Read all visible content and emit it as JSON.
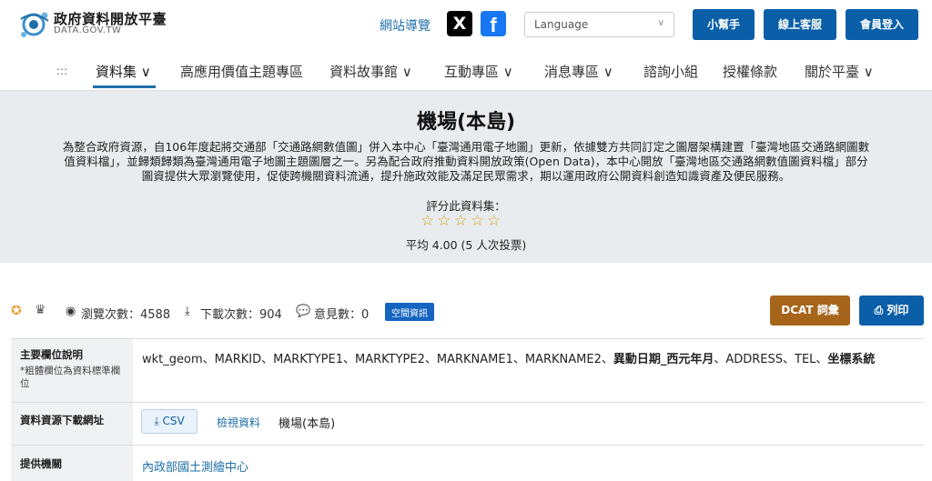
{
  "header": {
    "site_title": "政府資料開放平臺",
    "site_sub": "DATA.GOV.TW",
    "sitemap": "網站導覽",
    "language_placeholder": "Language",
    "btn_helper": "小幫手",
    "btn_service": "線上客服",
    "btn_login": "會員登入",
    "social_x": "X",
    "social_fb": "f"
  },
  "nav": {
    "menu_icon": ":::",
    "items": [
      "資料集 ∨",
      "高應用價值主題專區",
      "資料故事館 ∨",
      "互動專區 ∨",
      "消息專區 ∨",
      "諮詢小組",
      "授權條款",
      "關於平臺 ∨"
    ]
  },
  "hero": {
    "title": "機場(本島)",
    "description": "為整合政府資源，自106年度起將交通部「交通路網數值圖」併入本中心「臺灣通用電子地圖」更新，依據雙方共同訂定之圖層架構建置「臺灣地區交通路網圖數值資料檔」，並歸類歸類為臺灣通用電子地圖主題圖層之一。另為配合政府推動資料開放政策(Open Data)，本中心開放「臺灣地區交通路網數值圖資料檔」部分圖資提供大眾瀏覽使用，促使跨機關資料流通，提升施政效能及滿足民眾需求，期以運用政府公開資料創造知識資產及便民服務。",
    "rate_label": "評分此資料集：",
    "stars": "☆☆☆☆☆",
    "average": "平均 4.00 (5 人次投票)"
  },
  "stats": {
    "views": "瀏覽次數：4588",
    "downloads": "下載次數：904",
    "comments": "意見數：0",
    "tag": "空間資訊",
    "btn_dcat": "DCAT 詞彙",
    "btn_print": "列印"
  },
  "table": {
    "fields_label": "主要欄位說明",
    "fields_note": "*粗體欄位為資料標準欄位",
    "fields_plain_1": "wkt_geom、MARKID、MARKTYPE1、MARKTYPE2、MARKNAME1、MARKNAME2、",
    "fields_bold_1": "異動日期_西元年月",
    "fields_plain_2": "、ADDRESS、TEL、",
    "fields_bold_2": "坐標系統",
    "download_label": "資料資源下載網址",
    "csv": "CSV",
    "view_data": "檢視資料",
    "resource_name": "機場(本島)",
    "provider_label": "提供機關",
    "provider": "內政部國土測繪中心"
  }
}
